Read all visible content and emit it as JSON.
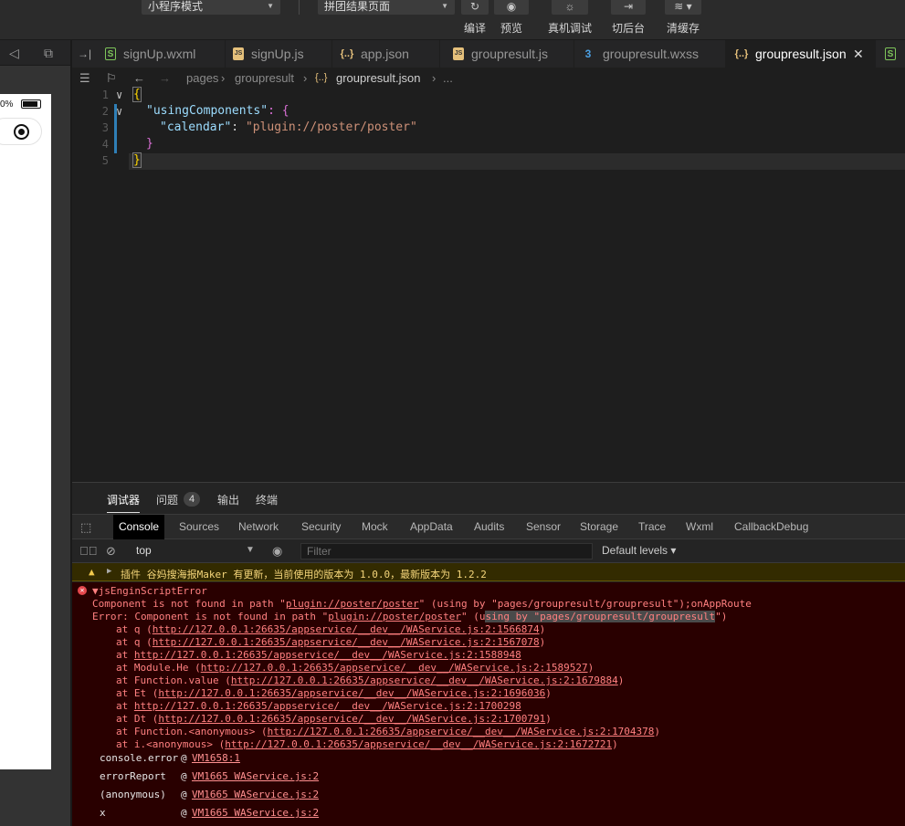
{
  "toolbar": {
    "mode_select": "小程序模式",
    "compile_select": "拼团结果页面",
    "buttons": [
      {
        "label": "编译",
        "icon": "refresh-icon"
      },
      {
        "label": "预览",
        "icon": "eye-icon"
      },
      {
        "label": "真机调试",
        "icon": "bug-icon"
      },
      {
        "label": "切后台",
        "icon": "switch-background-icon"
      },
      {
        "label": "清缓存",
        "icon": "layers-icon"
      }
    ]
  },
  "simulator": {
    "battery_text": "0%"
  },
  "tabs": [
    {
      "label": "signUp.wxml",
      "type": "wxml",
      "active": false
    },
    {
      "label": "signUp.js",
      "type": "js",
      "active": false
    },
    {
      "label": "app.json",
      "type": "json",
      "active": false
    },
    {
      "label": "groupresult.js",
      "type": "js",
      "active": false
    },
    {
      "label": "groupresult.wxss",
      "type": "css",
      "active": false
    },
    {
      "label": "groupresult.json",
      "type": "json",
      "active": true,
      "close": "✕"
    }
  ],
  "breadcrumb": [
    "pages",
    "groupresult",
    "groupresult.json",
    "..."
  ],
  "editor": {
    "lines": [
      "1",
      "2",
      "3",
      "4",
      "5"
    ],
    "code": {
      "l1": "{",
      "l2_key": "\"usingComponents\"",
      "l2_rest": ": {",
      "l3_key": "\"calendar\"",
      "l3_sep": ": ",
      "l3_val": "\"plugin://poster/poster\"",
      "l4": "}",
      "l5": "}"
    }
  },
  "devtools": {
    "top_tabs": {
      "debugger": "调试器",
      "issues": "问题",
      "issues_count": "4",
      "output": "输出",
      "terminal": "终端"
    },
    "panel_tabs": [
      "Console",
      "Sources",
      "Network",
      "Security",
      "Mock",
      "AppData",
      "Audits",
      "Sensor",
      "Storage",
      "Trace",
      "Wxml",
      "CallbackDebug"
    ],
    "context": "top",
    "filter_placeholder": "Filter",
    "levels": "Default levels"
  },
  "console": {
    "warning": "插件 谷妈搜海报Maker 有更新，当前使用的版本为 1.0.0，最新版本为 1.2.2",
    "error_title": "jsEnginScriptError",
    "error_line1_pre": "Component is not found in path \"",
    "error_line1_path": "plugin://poster/poster",
    "error_line1_post": "\" (using by \"pages/groupresult/groupresult\");onAppRoute",
    "error_line2_pre": "Error: Component is not found in path \"",
    "error_line2_path": "plugin://poster/poster",
    "error_line2_mid": "\" (u",
    "error_line2_hl": "sing by \"pages/groupresult/groupresult",
    "error_line2_post": "\")",
    "stack": [
      {
        "pre": "at q (",
        "url": "http://127.0.0.1:26635/appservice/__dev__/WAService.js:2:1566874",
        "post": ")"
      },
      {
        "pre": "at q (",
        "url": "http://127.0.0.1:26635/appservice/__dev__/WAService.js:2:1567078",
        "post": ")"
      },
      {
        "pre": "at ",
        "url": "http://127.0.0.1:26635/appservice/__dev__/WAService.js:2:1588948",
        "post": ""
      },
      {
        "pre": "at Module.He (",
        "url": "http://127.0.0.1:26635/appservice/__dev__/WAService.js:2:1589527",
        "post": ")"
      },
      {
        "pre": "at Function.value (",
        "url": "http://127.0.0.1:26635/appservice/__dev__/WAService.js:2:1679884",
        "post": ")"
      },
      {
        "pre": "at Et (",
        "url": "http://127.0.0.1:26635/appservice/__dev__/WAService.js:2:1696036",
        "post": ")"
      },
      {
        "pre": "at ",
        "url": "http://127.0.0.1:26635/appservice/__dev__/WAService.js:2:1700298",
        "post": ""
      },
      {
        "pre": "at Dt (",
        "url": "http://127.0.0.1:26635/appservice/__dev__/WAService.js:2:1700791",
        "post": ")"
      },
      {
        "pre": "at Function.<anonymous> (",
        "url": "http://127.0.0.1:26635/appservice/__dev__/WAService.js:2:1704378",
        "post": ")"
      },
      {
        "pre": "at i.<anonymous> (",
        "url": "http://127.0.0.1:26635/appservice/__dev__/WAService.js:2:1672721",
        "post": ")"
      }
    ],
    "frames": [
      {
        "name": "console.error",
        "src": "VM1658:1"
      },
      {
        "name": "errorReport",
        "src": "VM1665 WAService.js:2"
      },
      {
        "name": "(anonymous)",
        "src": "VM1665 WAService.js:2"
      },
      {
        "name": "x",
        "src": "VM1665 WAService.js:2"
      }
    ]
  }
}
